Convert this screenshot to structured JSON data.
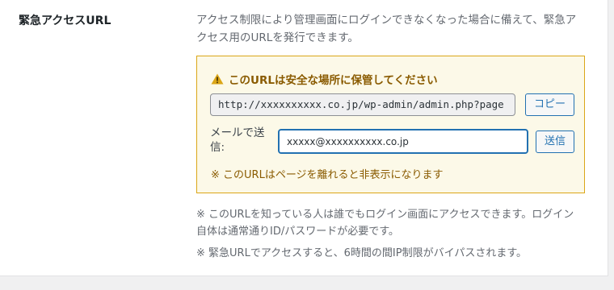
{
  "row": {
    "label": "緊急アクセスURL"
  },
  "description": "アクセス制限により管理画面にログインできなくなった場合に備えて、緊急アクセス用のURLを発行できます。",
  "notice": {
    "warning_icon": "warning-triangle-icon",
    "title": "このURLは安全な場所に保管してください",
    "url": "http://xxxxxxxxxx.co.jp/wp-admin/admin.php?page",
    "copy_label": "コピー",
    "mail_label": "メールで送信:",
    "mail_value": "xxxxx@xxxxxxxxxx.co.jp",
    "send_label": "送信",
    "hide_note": "※ このURLはページを離れると非表示になります"
  },
  "notes": [
    "※ このURLを知っている人は誰でもログイン画面にアクセスできます。ログイン自体は通常通りID/パスワードが必要です。",
    "※ 緊急URLでアクセスすると、6時間の間IP制限がバイパスされます。"
  ],
  "colors": {
    "notice_bg": "#fcf9e8",
    "notice_border": "#dba617",
    "notice_text": "#8a5b00",
    "accent": "#2271b1",
    "warning_icon": "#dba617"
  }
}
